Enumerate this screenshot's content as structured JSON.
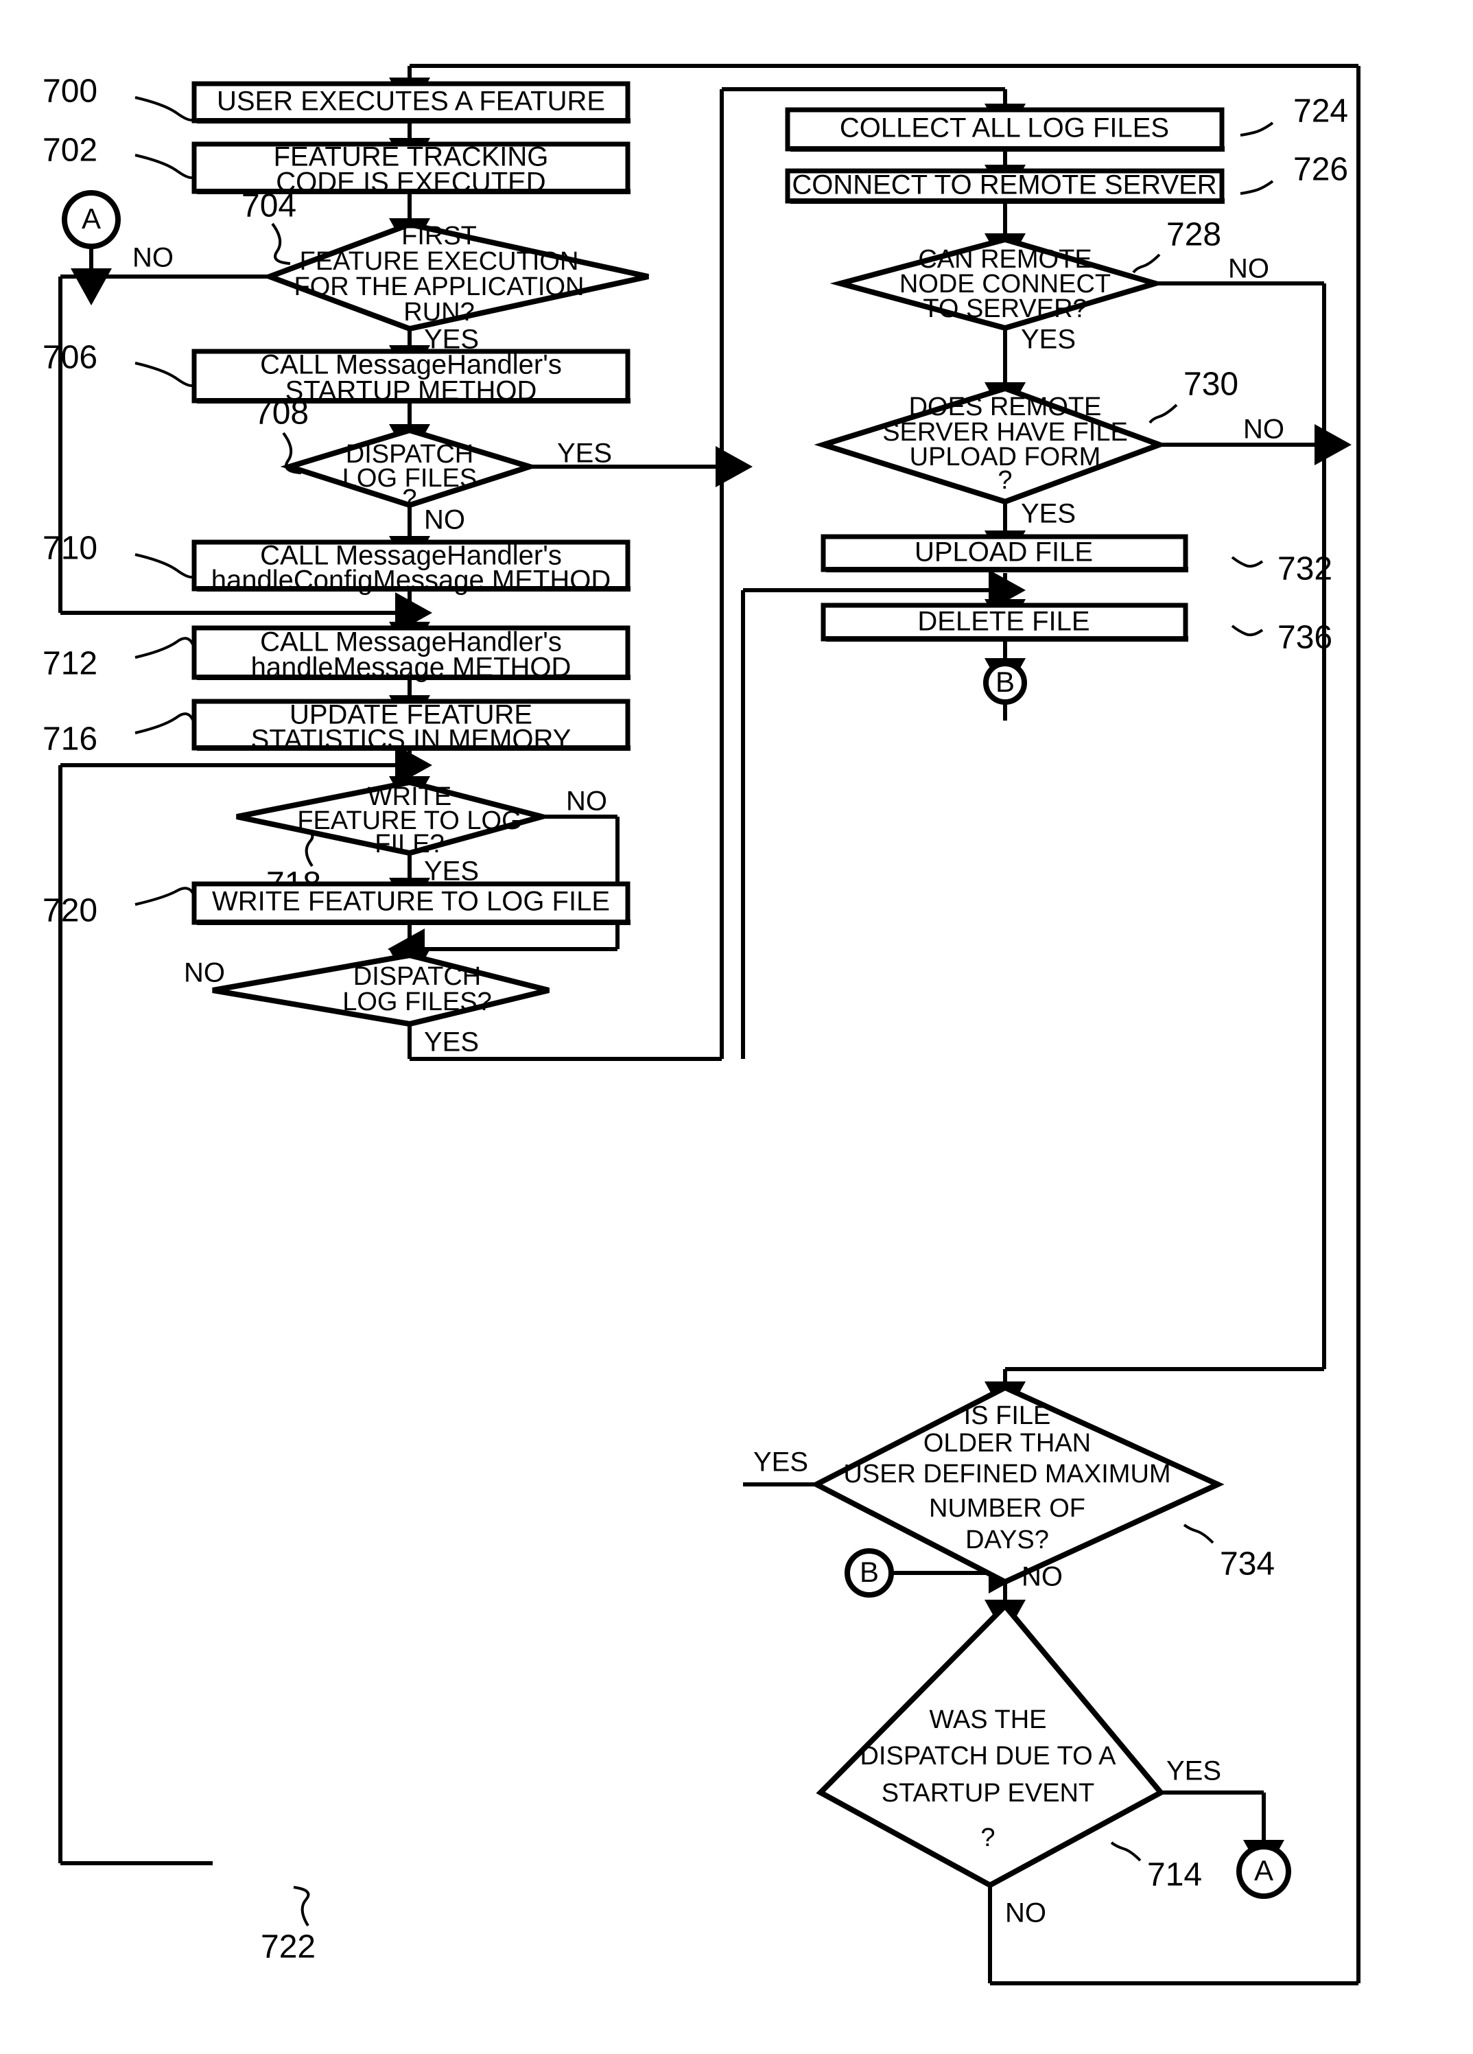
{
  "figure": {
    "type": "patent-flowchart",
    "background_color": "#ffffff",
    "line_color": "#000000"
  },
  "nodes": {
    "n700": {
      "ref": "700",
      "label": "USER EXECUTES A FEATURE",
      "shape": "process"
    },
    "n702": {
      "ref": "702",
      "line1": "FEATURE TRACKING",
      "line2": "CODE IS EXECUTED",
      "shape": "process"
    },
    "n704": {
      "ref": "704",
      "line1": "FIRST",
      "line2": "FEATURE EXECUTION",
      "line3": "FOR THE APPLICATION",
      "line4": "RUN?",
      "shape": "decision"
    },
    "n706": {
      "ref": "706",
      "line1": "CALL MessageHandler's",
      "line2": "STARTUP METHOD",
      "shape": "process"
    },
    "n708": {
      "ref": "708",
      "line1": "DISPATCH",
      "line2": "LOG FILES",
      "line3": "?",
      "shape": "decision"
    },
    "n710": {
      "ref": "710",
      "line1": "CALL MessageHandler's",
      "line2": "handleConfigMessage METHOD",
      "shape": "process"
    },
    "n712": {
      "ref": "712",
      "line1": "CALL MessageHandler's",
      "line2": "handleMessage  METHOD",
      "shape": "process"
    },
    "n716": {
      "ref": "716",
      "line1": "UPDATE FEATURE",
      "line2": "STATISTICS IN MEMORY",
      "shape": "process"
    },
    "n718": {
      "ref": "718",
      "line1": "WRITE",
      "line2": "FEATURE TO LOG",
      "line3": "FILE?",
      "shape": "decision"
    },
    "n720": {
      "ref": "720",
      "label": "WRITE FEATURE TO LOG FILE",
      "shape": "process"
    },
    "n722": {
      "ref": "722",
      "line1": "DISPATCH",
      "line2": "LOG FILES?",
      "shape": "decision"
    },
    "n724": {
      "ref": "724",
      "label": "COLLECT ALL LOG FILES",
      "shape": "process"
    },
    "n726": {
      "ref": "726",
      "label": "CONNECT TO REMOTE SERVER",
      "shape": "process"
    },
    "n728": {
      "ref": "728",
      "line1": "CAN REMOTE",
      "line2": "NODE CONNECT",
      "line3": "TO SERVER?",
      "shape": "decision"
    },
    "n730": {
      "ref": "730",
      "line1": "DOES REMOTE",
      "line2": "SERVER HAVE FILE",
      "line3": "UPLOAD FORM",
      "line4": "?",
      "shape": "decision"
    },
    "n732": {
      "ref": "732",
      "label": "UPLOAD FILE",
      "shape": "process"
    },
    "n736": {
      "ref": "736",
      "label": "DELETE FILE",
      "shape": "process"
    },
    "n734": {
      "ref": "734",
      "line1": "IS FILE",
      "line2": "OLDER THAN",
      "line3": "USER DEFINED MAXIMUM",
      "line4": "NUMBER OF",
      "line5": "DAYS?",
      "shape": "decision"
    },
    "n714": {
      "ref": "714",
      "line1": "WAS THE",
      "line2": "DISPATCH DUE TO A",
      "line3": "STARTUP EVENT",
      "line4": "?",
      "shape": "decision"
    }
  },
  "connectors": {
    "a_top": {
      "letter": "A",
      "shape": "circle"
    },
    "a_bottom": {
      "letter": "A",
      "shape": "circle"
    },
    "b_top": {
      "letter": "B",
      "shape": "circle"
    },
    "b_bottom": {
      "letter": "B",
      "shape": "circle"
    }
  },
  "edge_labels": {
    "e704_no": "NO",
    "e704_yes": "YES",
    "e708_yes": "YES",
    "e708_no": "NO",
    "e718_no": "NO",
    "e718_yes": "YES",
    "e722_no": "NO",
    "e722_yes": "YES",
    "e728_no": "NO",
    "e728_yes": "YES",
    "e730_no": "NO",
    "e730_yes": "YES",
    "e734_yes": "YES",
    "e734_no": "NO",
    "e714_yes": "YES",
    "e714_no": "NO"
  }
}
